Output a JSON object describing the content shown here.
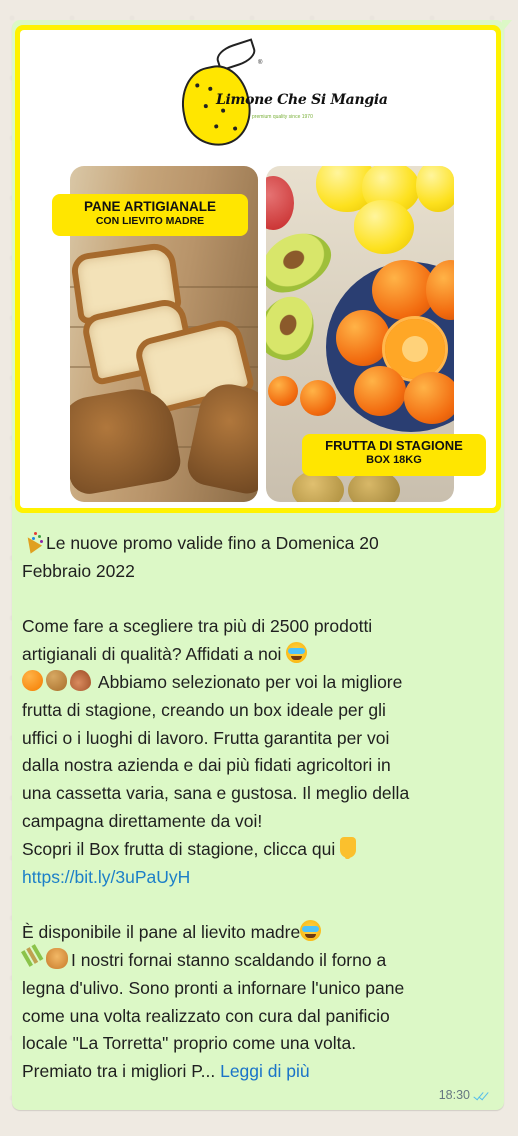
{
  "message": {
    "image": {
      "logo_name": "Limone Che Si Mangia",
      "logo_tagline": "premium quality since 1970",
      "logo_reg": "®",
      "bread_label_line1": "PANE ARTIGIANALE",
      "bread_label_line2": "CON LIEVITO MADRE",
      "fruit_label_line1": "FRUTTA DI STAGIONE",
      "fruit_label_line2": "BOX 18KG"
    },
    "lines": [
      "Le nuove promo valide fino a Domenica 20",
      "Febbraio 2022",
      "Come fare a scegliere tra più di 2500 prodotti",
      "artigianali di qualità? Affidati a noi",
      "Abbiamo selezionato per voi la migliore",
      "frutta di stagione, creando un box ideale per gli",
      "uffici o i luoghi di lavoro. Frutta garantita per voi",
      "dalla nostra azienda e dai più fidati agricoltori in",
      "una cassetta varia, sana e gustosa. Il meglio della",
      "campagna direttamente da voi!",
      "Scopri il Box frutta di stagione, clicca qui",
      "https://bit.ly/3uPaUyH",
      "È disponibile il pane al lievito madre",
      "I nostri fornai stanno scaldando il forno a",
      "legna d'ulivo. Sono pronti a infornare l'unico pane",
      "come una volta realizzato con cura dal panificio",
      "locale \"La Torretta\" proprio come una volta.",
      "Premiato tra i migliori P..."
    ],
    "read_more": "Leggi di più",
    "time": "18:30",
    "colors": {
      "bubble": "#dcf8c6",
      "chat_background": "#efeae2",
      "link": "#1c7fc8",
      "frame": "#fff200",
      "read_ticks": "#53bdeb"
    },
    "icons": [
      "party-popper-icon",
      "star-struck-face-icon",
      "orange-icon",
      "potato-icon",
      "onion-icon",
      "pointing-down-icon",
      "wheat-icon",
      "bread-icon",
      "double-check-icon"
    ]
  }
}
